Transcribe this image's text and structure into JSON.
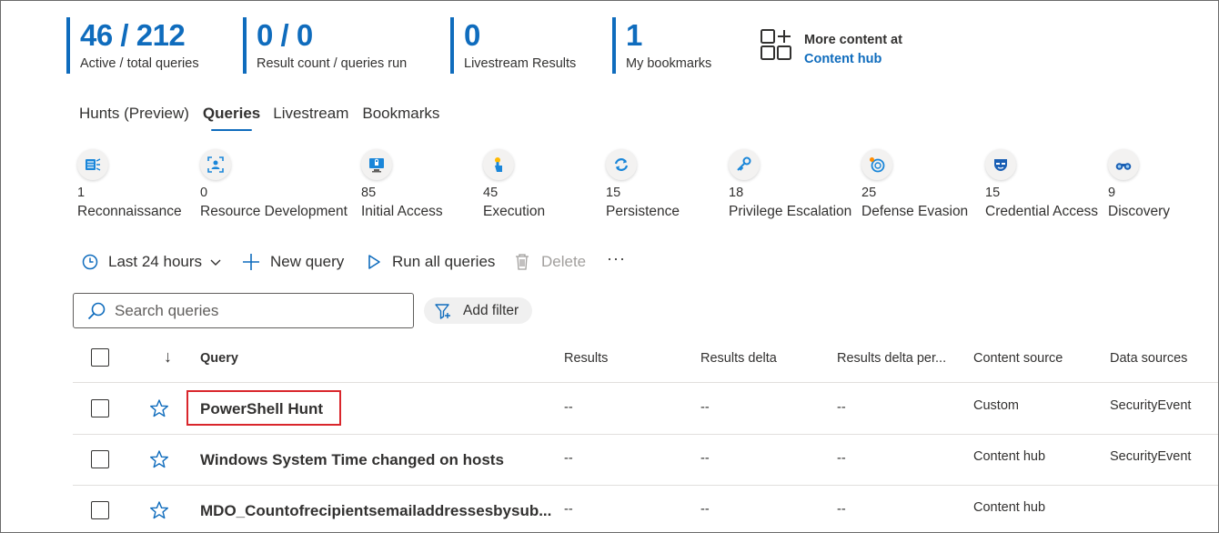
{
  "stats": [
    {
      "value": "46 / 212",
      "label": "Active / total queries"
    },
    {
      "value": "0 / 0",
      "label": "Result count / queries run"
    },
    {
      "value": "0",
      "label": "Livestream Results"
    },
    {
      "value": "1",
      "label": "My bookmarks"
    }
  ],
  "content_hub": {
    "line1": "More content at",
    "link": "Content hub",
    "icon": "grid-add-icon"
  },
  "tabs": [
    {
      "label": "Hunts (Preview)",
      "active": false
    },
    {
      "label": "Queries",
      "active": true
    },
    {
      "label": "Livestream",
      "active": false
    },
    {
      "label": "Bookmarks",
      "active": false
    }
  ],
  "tactics": [
    {
      "count": "1",
      "name": "Reconnaissance",
      "icon": "reconnaissance-icon"
    },
    {
      "count": "0",
      "name": "Resource Development",
      "icon": "resource-development-icon"
    },
    {
      "count": "85",
      "name": "Initial Access",
      "icon": "initial-access-icon"
    },
    {
      "count": "45",
      "name": "Execution",
      "icon": "execution-icon"
    },
    {
      "count": "15",
      "name": "Persistence",
      "icon": "persistence-icon"
    },
    {
      "count": "18",
      "name": "Privilege Escalation",
      "icon": "privilege-escalation-icon"
    },
    {
      "count": "25",
      "name": "Defense Evasion",
      "icon": "defense-evasion-icon"
    },
    {
      "count": "15",
      "name": "Credential Access",
      "icon": "credential-access-icon"
    },
    {
      "count": "9",
      "name": "Discovery",
      "icon": "discovery-icon"
    }
  ],
  "toolbar": {
    "time_range": "Last 24 hours",
    "new_query": "New query",
    "run_all": "Run all queries",
    "delete": "Delete",
    "more": "···"
  },
  "search": {
    "placeholder": "Search queries"
  },
  "filter": {
    "label": "Add filter"
  },
  "table": {
    "sort_indicator": "↓",
    "columns": [
      "Query",
      "Results",
      "Results delta",
      "Results delta per...",
      "Content source",
      "Data sources"
    ],
    "rows": [
      {
        "query": "PowerShell Hunt",
        "results": "--",
        "delta": "--",
        "delta_pct": "--",
        "source": "Custom",
        "data_sources": "SecurityEvent",
        "highlighted": true
      },
      {
        "query": "Windows System Time changed on hosts",
        "results": "--",
        "delta": "--",
        "delta_pct": "--",
        "source": "Content hub",
        "data_sources": "SecurityEvent",
        "highlighted": false
      },
      {
        "query": "MDO_Countofrecipientsemailaddressesbysub...",
        "results": "--",
        "delta": "--",
        "delta_pct": "--",
        "source": "Content hub",
        "data_sources": "",
        "highlighted": false
      }
    ]
  },
  "colors": {
    "accent": "#0f6cbd",
    "highlight_border": "#d9262c"
  }
}
